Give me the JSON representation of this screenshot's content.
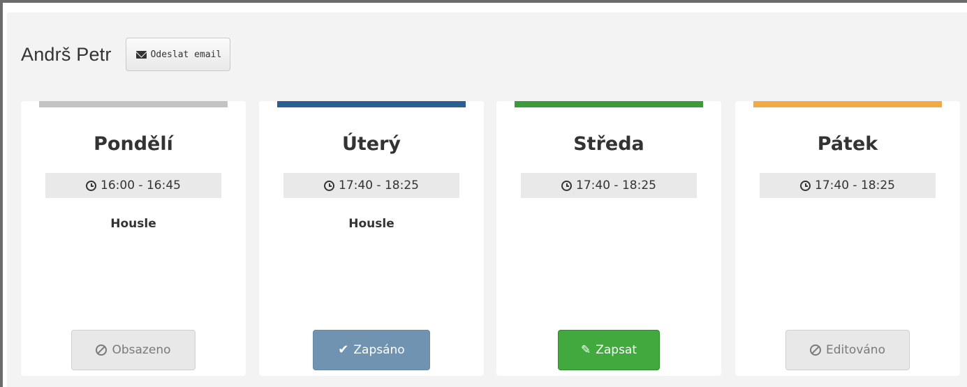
{
  "header": {
    "name": "Andrš Petr",
    "email_button": "Odeslat email"
  },
  "icons": {
    "envelope": "envelope-icon",
    "clock": "clock-icon",
    "ban": "ban-icon",
    "check": "check-icon",
    "pencil": "pencil-icon"
  },
  "colors": {
    "monday": "#c3c3c3",
    "tuesday": "#2a5f93",
    "wednesday": "#3b9a3a",
    "friday": "#f0ab44"
  },
  "days": [
    {
      "day": "Pondělí",
      "time": "16:00 - 16:45",
      "subject": "Housle",
      "action": "Obsazeno"
    },
    {
      "day": "Úterý",
      "time": "17:40 - 18:25",
      "subject": "Housle",
      "action": "Zapsáno"
    },
    {
      "day": "Středa",
      "time": "17:40 - 18:25",
      "subject": "",
      "action": "Zapsat"
    },
    {
      "day": "Pátek",
      "time": "17:40 - 18:25",
      "subject": "",
      "action": "Editováno"
    }
  ]
}
